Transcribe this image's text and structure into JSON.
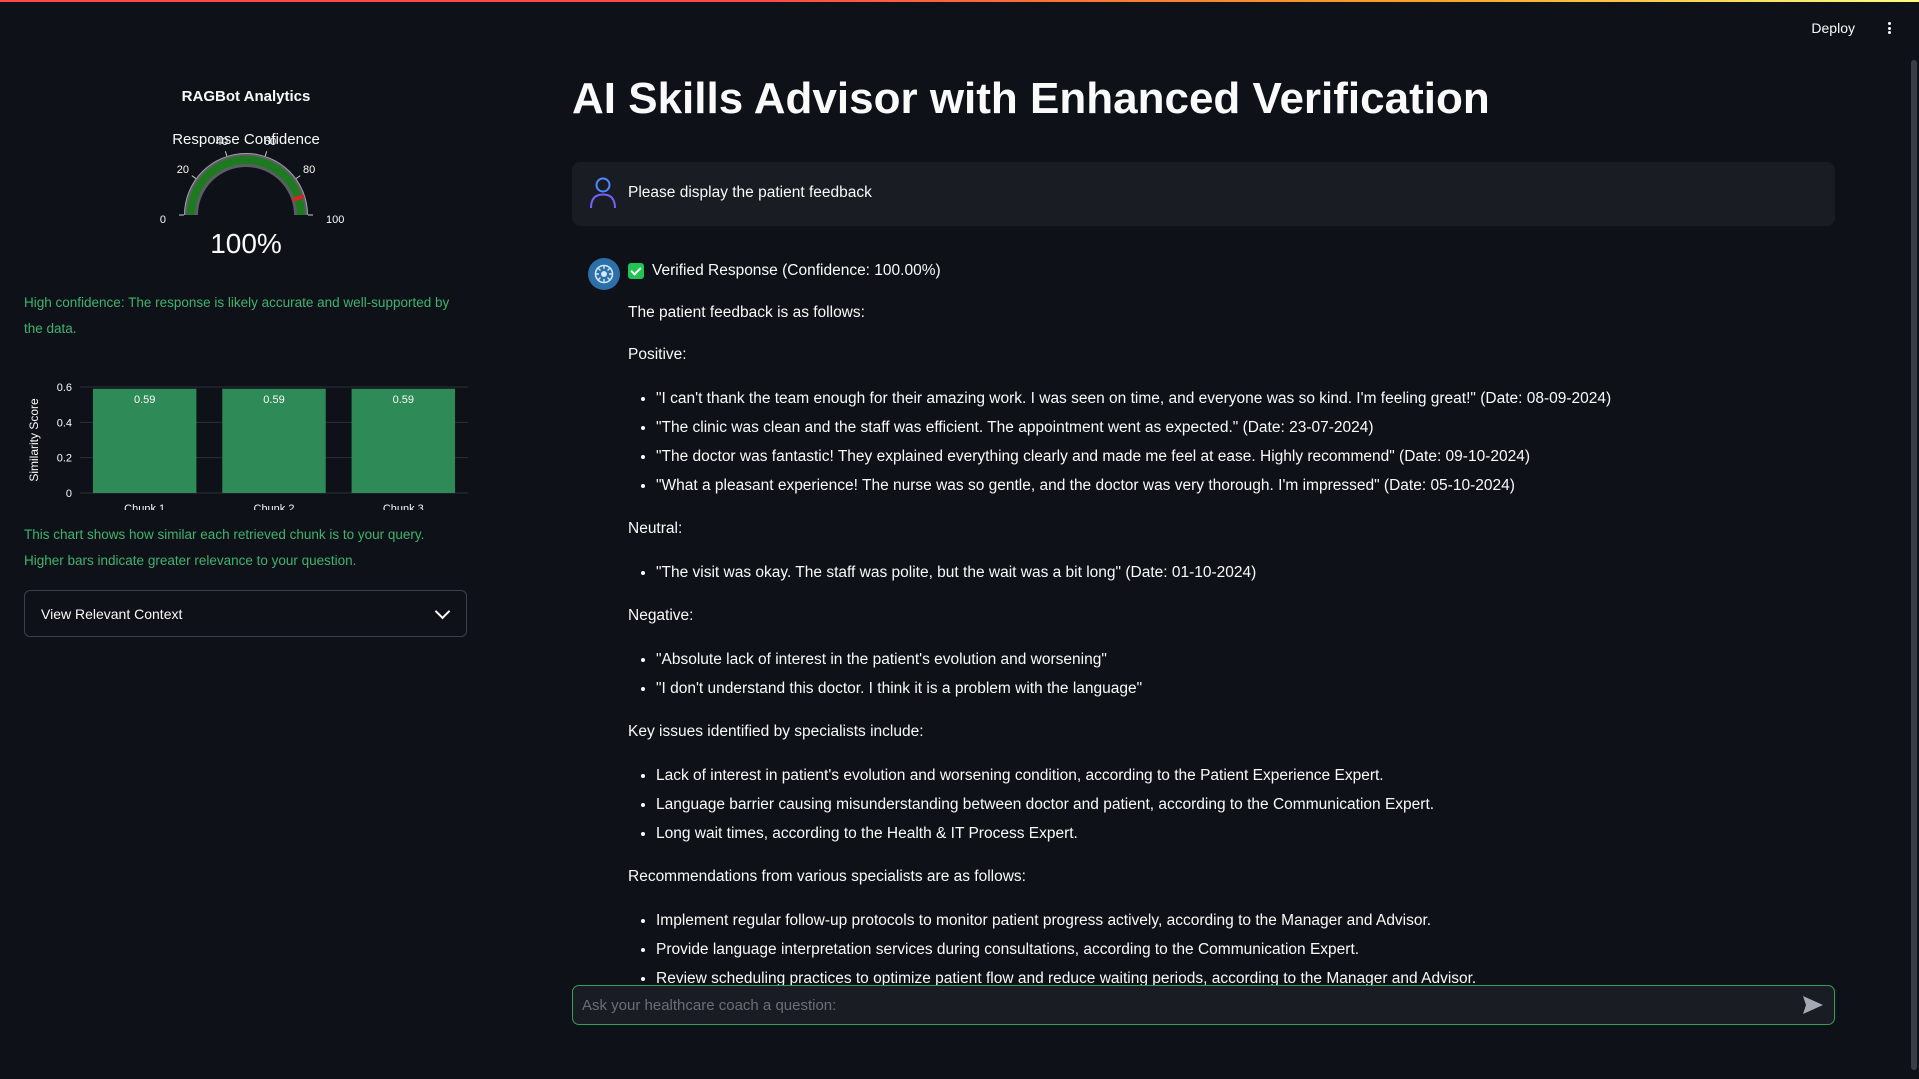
{
  "header": {
    "deploy_label": "Deploy",
    "menu_icon": "kebab-menu-icon"
  },
  "sidebar": {
    "title": "RAGBot Analytics",
    "gauge": {
      "title": "Response Confidence",
      "value": 100,
      "value_label": "100%",
      "ticks": [
        "0",
        "20",
        "40",
        "60",
        "80",
        "100"
      ],
      "bar_color": "#1e7a1e",
      "threshold": 90,
      "threshold_color": "#d62728"
    },
    "confidence_caption": "High confidence: The response is likely accurate and well-supported by the data.",
    "chart_caption": "This chart shows how similar each retrieved chunk is to your query. Higher bars indicate greater relevance to your question.",
    "expander_label": "View Relevant Context"
  },
  "chart_data": {
    "type": "bar",
    "categories": [
      "Chunk 1",
      "Chunk 2",
      "Chunk 3"
    ],
    "values": [
      0.59,
      0.59,
      0.59
    ],
    "value_labels": [
      "0.59",
      "0.59",
      "0.59"
    ],
    "xlabel": "",
    "ylabel": "Similarity Score",
    "ylim": [
      0,
      0.6
    ],
    "yticks": [
      "0",
      "0.2",
      "0.4",
      "0.6"
    ],
    "bar_color": "#2e8b57",
    "grid": true
  },
  "main": {
    "title": "AI Skills Advisor with Enhanced Verification",
    "user_message": "Please display the patient feedback",
    "verified_label": "Verified Response (Confidence: 100.00%)",
    "intro": "The patient feedback is as follows:",
    "sections": [
      {
        "heading": "Positive:",
        "items": [
          "\"I can't thank the team enough for their amazing work. I was seen on time, and everyone was so kind. I'm feeling great!\" (Date: 08-09-2024)",
          "\"The clinic was clean and the staff was efficient. The appointment went as expected.\" (Date: 23-07-2024)",
          "\"The doctor was fantastic! They explained everything clearly and made me feel at ease. Highly recommend\" (Date: 09-10-2024)",
          "\"What a pleasant experience! The nurse was so gentle, and the doctor was very thorough. I'm impressed\" (Date: 05-10-2024)"
        ]
      },
      {
        "heading": "Neutral:",
        "items": [
          "\"The visit was okay. The staff was polite, but the wait was a bit long\" (Date: 01-10-2024)"
        ]
      },
      {
        "heading": "Negative:",
        "items": [
          "\"Absolute lack of interest in the patient's evolution and worsening\"",
          "\"I don't understand this doctor. I think it is a problem with the language\""
        ]
      },
      {
        "heading": "Key issues identified by specialists include:",
        "items": [
          "Lack of interest in patient's evolution and worsening condition, according to the Patient Experience Expert.",
          "Language barrier causing misunderstanding between doctor and patient, according to the Communication Expert.",
          "Long wait times, according to the Health & IT Process Expert."
        ]
      },
      {
        "heading": "Recommendations from various specialists are as follows:",
        "items": [
          "Implement regular follow-up protocols to monitor patient progress actively, according to the Manager and Advisor.",
          "Provide language interpretation services during consultations, according to the Communication Expert.",
          "Review scheduling practices to optimize patient flow and reduce waiting periods, according to the Manager and Advisor."
        ]
      }
    ],
    "chat_placeholder": "Ask your healthcare coach a question:"
  }
}
